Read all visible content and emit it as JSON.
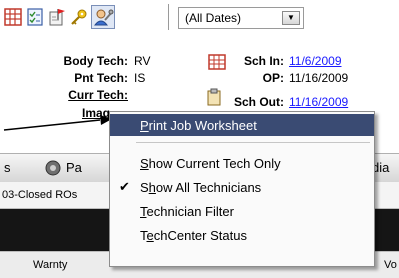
{
  "toolbar": {
    "icons": [
      "grid-icon",
      "checklist-icon",
      "flag-icon",
      "key-icon",
      "tech-wrench-icon"
    ],
    "date_filter": "(All Dates)"
  },
  "info": {
    "body_tech_label": "Body Tech:",
    "body_tech_value": "RV",
    "pnt_tech_label": "Pnt Tech:",
    "pnt_tech_value": "IS",
    "curr_tech_label": "Curr Tech:",
    "imag_label": "Imag",
    "sch_in_label": "Sch In:",
    "sch_in_value": "11/6/2009",
    "op_label": "OP:",
    "op_value": "11/16/2009",
    "sch_out_label": "Sch Out:",
    "sch_out_value": "11/16/2009"
  },
  "tabs": {
    "left_fragment": "s",
    "pa_fragment": "Pa",
    "right_fragment": "dia"
  },
  "subtab": "03-Closed ROs",
  "columns": {
    "warranty": "Warnty",
    "last_fragment": "Vo"
  },
  "menu": {
    "items": [
      {
        "label": "Print Job Worksheet",
        "underline": "P",
        "rest": "rint Job Worksheet",
        "checked": false,
        "highlighted": true
      },
      {
        "label": "Show Current Tech Only",
        "underline": "S",
        "rest": "how Current Tech Only",
        "checked": false
      },
      {
        "label": "Show All Technicians",
        "underline": "h",
        "pre": "S",
        "rest": "ow All Technicians",
        "checked": true
      },
      {
        "label": "Technician Filter",
        "underline": "T",
        "rest": "echnician Filter",
        "checked": false
      },
      {
        "label": "TechCenter Status",
        "underline": "e",
        "pre": "T",
        "rest": "chCenter Status",
        "checked": false
      }
    ],
    "check_glyph": "✔",
    "highlight_color": "#3a4b73"
  }
}
